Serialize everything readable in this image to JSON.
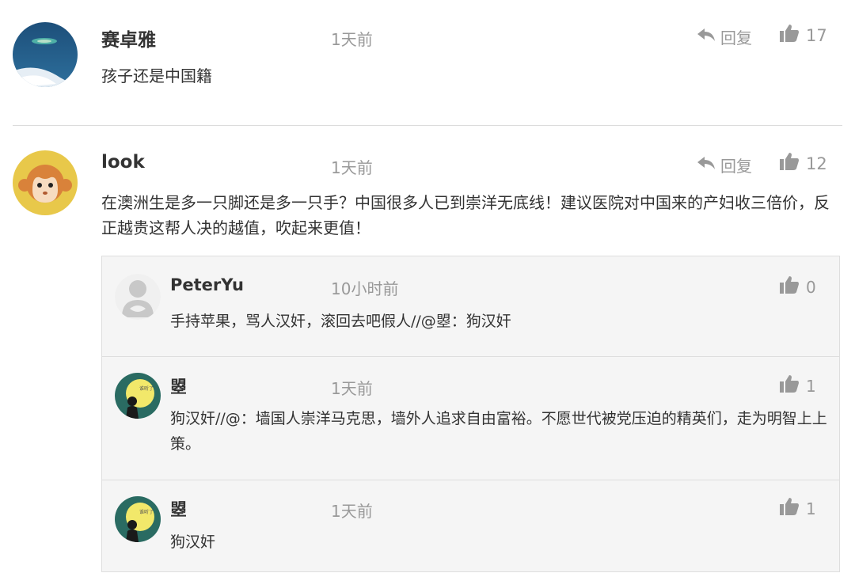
{
  "comments": [
    {
      "name": "赛卓雅",
      "time": "1天前",
      "reply_label": "回复",
      "likes": "17",
      "text": "孩子还是中国籍"
    },
    {
      "name": "look",
      "time": "1天前",
      "reply_label": "回复",
      "likes": "12",
      "text": "在澳洲生是多一只脚还是多一只手？中国很多人已到崇洋无底线！建议医院对中国来的产妇收三倍价，反正越贵这帮人决的越值，吹起来更值！",
      "replies": [
        {
          "name": "PeterYu",
          "time": "10小时前",
          "likes": "0",
          "text": "手持苹果，骂人汉奸，滚回去吧假人//@曌：狗汉奸"
        },
        {
          "name": "曌",
          "time": "1天前",
          "likes": "1",
          "text": "狗汉奸//@：墙国人崇洋马克思，墙外人追求自由富裕。不愿世代被党压迫的精英们，走为明智上上策。"
        },
        {
          "name": "曌",
          "time": "1天前",
          "likes": "1",
          "text": "狗汉奸"
        }
      ]
    }
  ],
  "avatar_text": "谁听了",
  "icons": {
    "reply": "reply-arrow-icon",
    "like": "thumbs-up-icon"
  },
  "colors": {
    "muted": "#999999",
    "nested_bg": "#f5f5f5",
    "monkey_bg": "#e8c84a",
    "moon": "#f2e86a"
  }
}
